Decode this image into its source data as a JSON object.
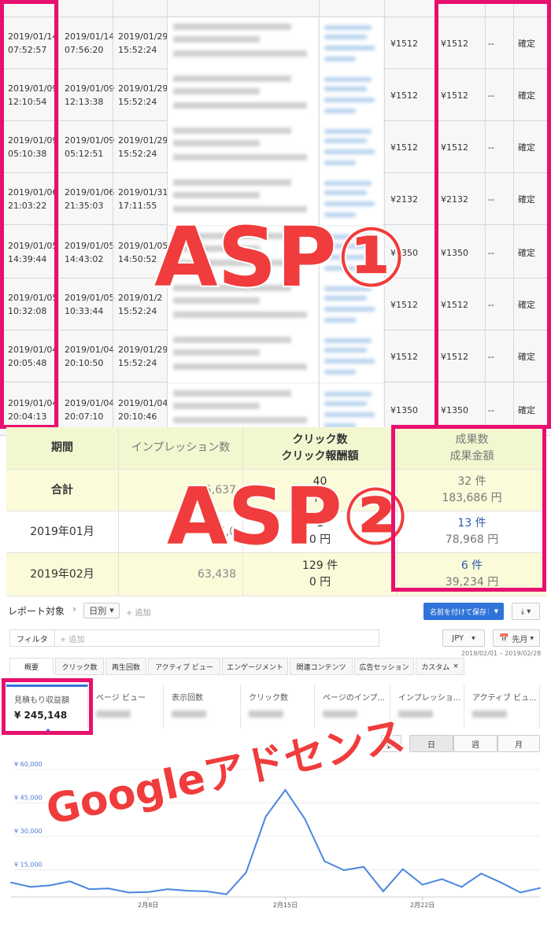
{
  "asp1": {
    "rows": [
      {
        "date1": "2019/01/14\n07:52:57",
        "date2": "2019/01/14\n07:56:20",
        "date3": "2019/01/29\n15:52:24",
        "amount": "¥1512",
        "reward": "¥1512",
        "dash": "--",
        "status": "確定"
      },
      {
        "date1": "2019/01/09\n12:10:54",
        "date2": "2019/01/09\n12:13:38",
        "date3": "2019/01/29\n15:52:24",
        "amount": "¥1512",
        "reward": "¥1512",
        "dash": "--",
        "status": "確定"
      },
      {
        "date1": "2019/01/09\n05:10:38",
        "date2": "2019/01/09\n05:12:51",
        "date3": "2019/01/29\n15:52:24",
        "amount": "¥1512",
        "reward": "¥1512",
        "dash": "--",
        "status": "確定"
      },
      {
        "date1": "2019/01/06\n21:03:22",
        "date2": "2019/01/06\n21:35:03",
        "date3": "2019/01/31\n17:11:55",
        "amount": "¥2132",
        "reward": "¥2132",
        "dash": "--",
        "status": "確定"
      },
      {
        "date1": "2019/01/05\n14:39:44",
        "date2": "2019/01/05\n14:43:02",
        "date3": "2019/01/05\n14:50:52",
        "amount": "¥1350",
        "reward": "¥1350",
        "dash": "--",
        "status": "確定"
      },
      {
        "date1": "2019/01/05\n10:32:08",
        "date2": "2019/01/05\n10:33:44",
        "date3": "2019/01/2\n15:52:24",
        "amount": "¥1512",
        "reward": "¥1512",
        "dash": "--",
        "status": "確定"
      },
      {
        "date1": "2019/01/04\n20:05:48",
        "date2": "2019/01/04\n20:10:50",
        "date3": "2019/01/29\n15:52:24",
        "amount": "¥1512",
        "reward": "¥1512",
        "dash": "--",
        "status": "確定"
      },
      {
        "date1": "2019/01/04\n20:04:13",
        "date2": "2019/01/04\n20:07:10",
        "date3": "2019/01/04\n20:10:46",
        "amount": "¥1350",
        "reward": "¥1350",
        "dash": "--",
        "status": "確定"
      }
    ],
    "overlay_label": "ASP①"
  },
  "asp2": {
    "headers": {
      "period": "期間",
      "impressions": "インプレッション数",
      "clicks_line1": "クリック数",
      "clicks_line2": "クリック報酬額",
      "results_line1": "成果数",
      "results_line2": "成果金額"
    },
    "rows": [
      {
        "period": "合計",
        "impressions": "75,637",
        "clicks_line1": "40",
        "clicks_line2": "円",
        "results_count": "32 件",
        "results_amount": "183,686 円"
      },
      {
        "period": "2019年01月",
        "impressions": "5,0",
        "clicks_line1": "1",
        "clicks_line2": "0 円",
        "results_count": "13 件",
        "results_amount": "78,968 円"
      },
      {
        "period": "2019年02月",
        "impressions": "63,438",
        "clicks_line1": "129 件",
        "clicks_line2": "0 円",
        "results_count": "6 件",
        "results_amount": "39,234 円"
      }
    ],
    "overlay_label": "ASP②"
  },
  "adsense": {
    "report_target": "レポート対象",
    "granularity": "日別",
    "add": "+ 追加",
    "save_button": "名前を付けて保存",
    "filter_label": "フィルタ",
    "filter_placeholder": "+ 追加",
    "currency": "JPY",
    "period_button": "先月",
    "date_range": "2019/02/01 – 2019/02/28",
    "tabs": [
      "概要",
      "クリック数",
      "再生回数",
      "アクティブ ビュー",
      "エンゲージメント",
      "関連コンテンツ",
      "広告セッション",
      "カスタム"
    ],
    "metrics": [
      {
        "label": "見積もり収益額",
        "value": "¥ 245,148"
      },
      {
        "label": "ページ ビュー"
      },
      {
        "label": "表示回数"
      },
      {
        "label": "クリック数"
      },
      {
        "label": "ページのインプ..."
      },
      {
        "label": "インプレッショ..."
      },
      {
        "label": "アクティブ ビュ..."
      }
    ],
    "view_buttons": {
      "day": "日",
      "week": "週",
      "month": "月"
    },
    "overlay_label": "Googleアドセンス",
    "chart_data": {
      "type": "line",
      "y_ticks": [
        "¥ 60,000",
        "¥ 45,000",
        "¥ 30,000",
        "¥ 15,000"
      ],
      "ylim": [
        0,
        60000
      ],
      "x_ticks": [
        "2月8日",
        "2月15日",
        "2月22日"
      ],
      "x": [
        1,
        2,
        3,
        4,
        5,
        6,
        7,
        8,
        9,
        10,
        11,
        12,
        13,
        14,
        15,
        16,
        17,
        18,
        19,
        20,
        21,
        22,
        23,
        24,
        25,
        26,
        27,
        28
      ],
      "series": [
        {
          "values": [
            6500,
            4500,
            5200,
            7000,
            3500,
            3800,
            2000,
            2200,
            3500,
            2800,
            2500,
            1200,
            11000,
            36000,
            48000,
            35000,
            16000,
            12000,
            13500,
            2500,
            12500,
            5500,
            8000,
            4500,
            10500,
            6500,
            2000,
            4000
          ]
        }
      ],
      "color": "#4a86e0"
    }
  }
}
